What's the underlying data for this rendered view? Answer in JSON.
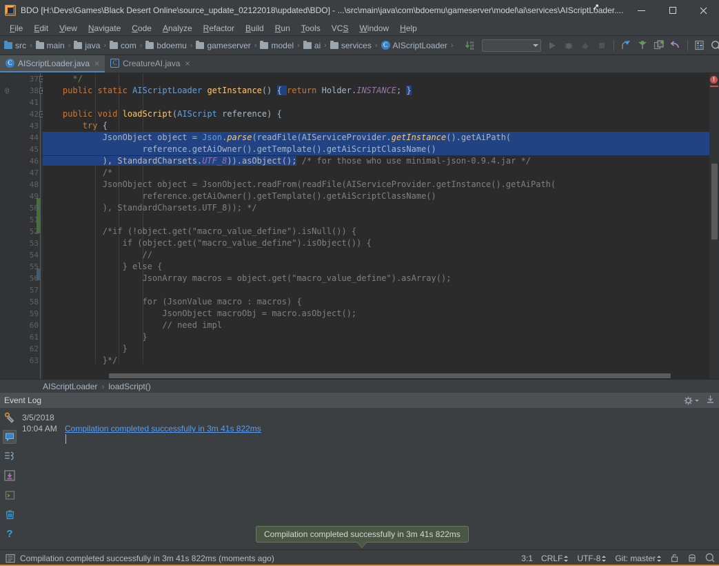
{
  "window": {
    "title": "BDO [H:\\Devs\\Games\\Black Desert Online\\source_update_02122018\\updated\\BDO] - ...\\src\\main\\java\\com\\bdoemu\\gameserver\\model\\ai\\services\\AIScriptLoader....",
    "app_icon": "intellij-idea-icon",
    "minimize_label": "Minimize",
    "maximize_label": "Maximize",
    "close_label": "Close"
  },
  "menubar": {
    "items": [
      {
        "label": "File",
        "mnemonic": "F"
      },
      {
        "label": "Edit",
        "mnemonic": "E"
      },
      {
        "label": "View",
        "mnemonic": "V"
      },
      {
        "label": "Navigate",
        "mnemonic": "N"
      },
      {
        "label": "Code",
        "mnemonic": "C"
      },
      {
        "label": "Analyze",
        "mnemonic": "A"
      },
      {
        "label": "Refactor",
        "mnemonic": "R"
      },
      {
        "label": "Build",
        "mnemonic": "B"
      },
      {
        "label": "Run",
        "mnemonic": "R"
      },
      {
        "label": "Tools",
        "mnemonic": "T"
      },
      {
        "label": "VCS",
        "mnemonic": "S"
      },
      {
        "label": "Window",
        "mnemonic": "W"
      },
      {
        "label": "Help",
        "mnemonic": "H"
      }
    ]
  },
  "navbar": {
    "breadcrumbs": [
      {
        "label": "src",
        "icon": "source-folder-icon"
      },
      {
        "label": "main",
        "icon": "folder-icon"
      },
      {
        "label": "java",
        "icon": "folder-icon"
      },
      {
        "label": "com",
        "icon": "folder-icon"
      },
      {
        "label": "bdoemu",
        "icon": "folder-icon"
      },
      {
        "label": "gameserver",
        "icon": "folder-icon"
      },
      {
        "label": "model",
        "icon": "folder-icon"
      },
      {
        "label": "ai",
        "icon": "folder-icon"
      },
      {
        "label": "services",
        "icon": "folder-icon"
      },
      {
        "label": "AIScriptLoader",
        "icon": "java-class-icon"
      }
    ],
    "separator": "›",
    "toolbar": [
      {
        "name": "sync-download-icon",
        "label": ""
      },
      {
        "name": "run-configurations-combo",
        "label": ""
      },
      {
        "name": "run-icon",
        "label": ""
      },
      {
        "name": "debug-icon",
        "label": ""
      },
      {
        "name": "coverage-icon",
        "label": ""
      },
      {
        "name": "stop-icon",
        "label": ""
      },
      {
        "name": "update-project-icon",
        "label": ""
      },
      {
        "name": "commit-changes-icon",
        "label": ""
      },
      {
        "name": "compare-with-icon",
        "label": ""
      },
      {
        "name": "revert-icon",
        "label": ""
      },
      {
        "name": "settings-icon",
        "label": ""
      },
      {
        "name": "search-everywhere-icon",
        "label": ""
      }
    ]
  },
  "tabs": [
    {
      "label": "AIScriptLoader.java",
      "icon": "java-class-icon",
      "active": true,
      "close": "×"
    },
    {
      "label": "CreatureAI.java",
      "icon": "java-class-icon",
      "active": false,
      "close": "×"
    }
  ],
  "editor": {
    "lines": [
      {
        "num": "37",
        "annot": "",
        "fold": "collapse",
        "selected": false,
        "indent": 1,
        "tokens": [
          {
            "t": "      */",
            "c": "str"
          }
        ]
      },
      {
        "num": "38",
        "annot": "@",
        "fold": "expand",
        "selected": false,
        "indent": 1,
        "tokens": [
          {
            "t": "    ",
            "c": "pln"
          },
          {
            "t": "public static ",
            "c": "kw"
          },
          {
            "t": "AIScriptLoader ",
            "c": "typ"
          },
          {
            "t": "getInstance",
            "c": "mth"
          },
          {
            "t": "() ",
            "c": "pln"
          },
          {
            "t": "{ ",
            "c": "selw"
          },
          {
            "t": "return ",
            "c": "kw"
          },
          {
            "t": "Holder.",
            "c": "pln"
          },
          {
            "t": "INSTANCE",
            "c": "statfld"
          },
          {
            "t": "; ",
            "c": "pln"
          },
          {
            "t": "}",
            "c": "selw"
          }
        ]
      },
      {
        "num": "41",
        "annot": "",
        "fold": "",
        "selected": false,
        "indent": 1,
        "tokens": []
      },
      {
        "num": "42",
        "annot": "",
        "fold": "collapse",
        "selected": false,
        "indent": 1,
        "tokens": [
          {
            "t": "    ",
            "c": "pln"
          },
          {
            "t": "public void ",
            "c": "kw"
          },
          {
            "t": "loadScript",
            "c": "mth"
          },
          {
            "t": "(",
            "c": "pln"
          },
          {
            "t": "AIScript",
            "c": "typ"
          },
          {
            "t": " reference) {",
            "c": "pln"
          }
        ]
      },
      {
        "num": "43",
        "annot": "",
        "fold": "",
        "selected": false,
        "indent": 2,
        "tokens": [
          {
            "t": "        ",
            "c": "pln"
          },
          {
            "t": "try ",
            "c": "kw"
          },
          {
            "t": "{",
            "c": "pln"
          }
        ]
      },
      {
        "num": "44",
        "annot": "",
        "fold": "",
        "selected": true,
        "indent": 3,
        "tokens": [
          {
            "t": "            JsonObject object = ",
            "c": "pln"
          },
          {
            "t": "Json",
            "c": "typ"
          },
          {
            "t": ".",
            "c": "pln"
          },
          {
            "t": "parse",
            "c": "mthi"
          },
          {
            "t": "(readFile(AIServiceProvider.",
            "c": "pln"
          },
          {
            "t": "getInstance",
            "c": "mthi"
          },
          {
            "t": "().getAiPath(",
            "c": "pln"
          }
        ]
      },
      {
        "num": "45",
        "annot": "",
        "fold": "",
        "selected": true,
        "indent": 3,
        "tokens": [
          {
            "t": "                    reference.getAiOwner().getTemplate().getAiScriptClassName()",
            "c": "pln"
          }
        ]
      },
      {
        "num": "46",
        "annot": "",
        "fold": "",
        "selected": false,
        "indent": 3,
        "tokens": [
          {
            "t": "            ), StandardCharsets.",
            "c": "selw"
          },
          {
            "t": "UTF_8",
            "c": "statfld-sel"
          },
          {
            "t": ")).asObject();",
            "c": "selw"
          },
          {
            "t": " /* for those who use minimal-json-0.9.4.jar */",
            "c": "cmt"
          }
        ]
      },
      {
        "num": "47",
        "annot": "",
        "fold": "",
        "selected": false,
        "indent": 3,
        "tokens": [
          {
            "t": "            /*",
            "c": "cmt"
          }
        ]
      },
      {
        "num": "48",
        "annot": "",
        "fold": "",
        "selected": false,
        "indent": 3,
        "tokens": [
          {
            "t": "            JsonObject object = JsonObject.readFrom(readFile(AIServiceProvider.getInstance().getAiPath(",
            "c": "cmt"
          }
        ]
      },
      {
        "num": "49",
        "annot": "",
        "fold": "",
        "selected": false,
        "indent": 3,
        "tokens": [
          {
            "t": "                    reference.getAiOwner().getTemplate().getAiScriptClassName()",
            "c": "cmt"
          }
        ]
      },
      {
        "num": "50",
        "annot": "",
        "fold": "",
        "selected": false,
        "indent": 3,
        "tokens": [
          {
            "t": "            ), StandardCharsets.UTF_8)); */",
            "c": "cmt"
          }
        ]
      },
      {
        "num": "51",
        "annot": "",
        "fold": "",
        "selected": false,
        "indent": 2,
        "tokens": []
      },
      {
        "num": "52",
        "annot": "",
        "fold": "",
        "selected": false,
        "indent": 2,
        "tokens": [
          {
            "t": "            /*if (!object.get(\"macro_value_define\").isNull()) {",
            "c": "cmt"
          }
        ]
      },
      {
        "num": "53",
        "annot": "",
        "fold": "",
        "selected": false,
        "indent": 3,
        "tokens": [
          {
            "t": "                if (object.get(\"macro_value_define\").isObject()) {",
            "c": "cmt"
          }
        ]
      },
      {
        "num": "54",
        "annot": "",
        "fold": "",
        "selected": false,
        "indent": 4,
        "tokens": [
          {
            "t": "                    //",
            "c": "cmt"
          }
        ]
      },
      {
        "num": "55",
        "annot": "",
        "fold": "",
        "selected": false,
        "indent": 3,
        "tokens": [
          {
            "t": "                } else {",
            "c": "cmt"
          }
        ]
      },
      {
        "num": "56",
        "annot": "",
        "fold": "",
        "selected": false,
        "indent": 4,
        "tokens": [
          {
            "t": "                    JsonArray macros = object.get(\"macro_value_define\").asArray();",
            "c": "cmt"
          }
        ]
      },
      {
        "num": "57",
        "annot": "",
        "fold": "",
        "selected": false,
        "indent": 4,
        "tokens": []
      },
      {
        "num": "58",
        "annot": "",
        "fold": "",
        "selected": false,
        "indent": 4,
        "tokens": [
          {
            "t": "                    for (JsonValue macro : macros) {",
            "c": "cmt"
          }
        ]
      },
      {
        "num": "59",
        "annot": "",
        "fold": "",
        "selected": false,
        "indent": 5,
        "tokens": [
          {
            "t": "                        JsonObject macroObj = macro.asObject();",
            "c": "cmt"
          }
        ]
      },
      {
        "num": "60",
        "annot": "",
        "fold": "",
        "selected": false,
        "indent": 5,
        "tokens": [
          {
            "t": "                        // need impl",
            "c": "cmt"
          }
        ]
      },
      {
        "num": "61",
        "annot": "",
        "fold": "",
        "selected": false,
        "indent": 5,
        "tokens": [
          {
            "t": "                    }",
            "c": "cmt"
          }
        ]
      },
      {
        "num": "62",
        "annot": "",
        "fold": "",
        "selected": false,
        "indent": 4,
        "tokens": [
          {
            "t": "                }",
            "c": "cmt"
          }
        ]
      },
      {
        "num": "63",
        "annot": "",
        "fold": "",
        "selected": false,
        "indent": 3,
        "tokens": [
          {
            "t": "            }*/",
            "c": "cmt"
          }
        ]
      }
    ],
    "error_marker": {
      "name": "error-stripe-icon",
      "glyph": "!"
    },
    "breadcrumb": {
      "class_name": "AIScriptLoader",
      "method_name": "loadScript()",
      "separator": "›"
    }
  },
  "event_log": {
    "title": "Event Log",
    "settings_icon": "gear-icon",
    "hide_icon": "hide-panel-icon",
    "date": "3/5/2018",
    "time": "10:04 AM",
    "message": "Compilation completed successfully in 3m 41s 822ms",
    "sidebar_icons": [
      {
        "name": "build-icon",
        "active": false
      },
      {
        "name": "event-log-icon",
        "active": true
      },
      {
        "name": "todo-icon",
        "active": false
      },
      {
        "name": "version-control-icon",
        "active": false
      },
      {
        "name": "terminal-icon",
        "active": false
      },
      {
        "name": "trash-icon",
        "active": false
      },
      {
        "name": "help-icon",
        "active": false
      }
    ]
  },
  "balloon": {
    "message": "Compilation completed successfully in 3m 41s 822ms"
  },
  "statusbar": {
    "icon": "memory-indicator-icon",
    "message": "Compilation completed successfully in 3m 41s 822ms (moments ago)",
    "caret_position": "3:1",
    "line_separator": "CRLF",
    "encoding": "UTF-8",
    "branch": "Git: master",
    "lock_icon": "unlock-icon",
    "inspection_icon": "hector-icon",
    "search_icon": "search-icon"
  },
  "colors": {
    "accent": "#d78d3e",
    "selection": "#214283",
    "link": "#589df6",
    "error": "#c75450",
    "balloon_bg": "#4a5743"
  }
}
